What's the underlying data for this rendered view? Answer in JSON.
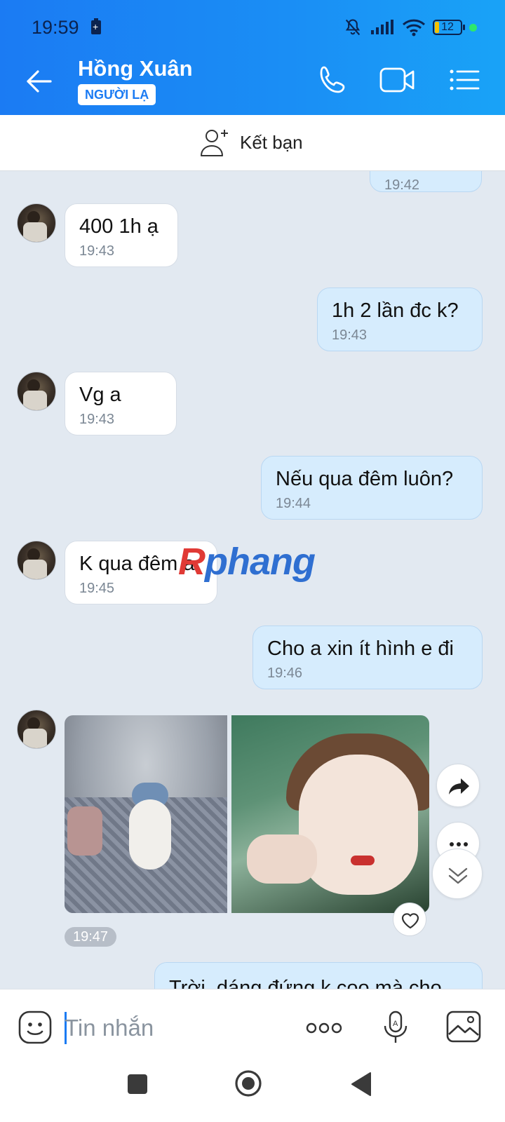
{
  "status_bar": {
    "time": "19:59",
    "battery_level": "12"
  },
  "header": {
    "contact_name": "Hồng Xuân",
    "badge": "NGƯỜI LẠ"
  },
  "friend_bar": {
    "label": "Kết bạn"
  },
  "messages": [
    {
      "dir": "out",
      "text": "",
      "time": "19:42"
    },
    {
      "dir": "in",
      "text": "400 1h ạ",
      "time": "19:43"
    },
    {
      "dir": "out",
      "text": "1h 2 lần đc k?",
      "time": "19:43"
    },
    {
      "dir": "in",
      "text": "Vg a",
      "time": "19:43"
    },
    {
      "dir": "out",
      "text": "Nếu qua đêm luôn?",
      "time": "19:44"
    },
    {
      "dir": "in",
      "text": "K qua đêm a",
      "time": "19:45"
    },
    {
      "dir": "out",
      "text": "Cho a xin ít hình e đi",
      "time": "19:46"
    },
    {
      "dir": "out",
      "text": "Trời, dáng đứng k coo mà cho",
      "time": ""
    }
  ],
  "photo_message": {
    "time": "19:47"
  },
  "watermark": {
    "first": "R",
    "rest": "phang"
  },
  "input": {
    "placeholder": "Tin nhắn"
  },
  "icons": {
    "back": "arrow-left-icon",
    "call": "phone-icon",
    "video": "video-camera-icon",
    "menu": "list-menu-icon",
    "add_friend": "add-user-icon",
    "share": "share-icon",
    "more": "more-dots-icon",
    "scroll_down": "double-chevron-down-icon",
    "like": "heart-icon",
    "emoji": "emoji-icon",
    "options": "more-horizontal-icon",
    "voice": "microphone-icon",
    "gallery": "image-icon"
  }
}
